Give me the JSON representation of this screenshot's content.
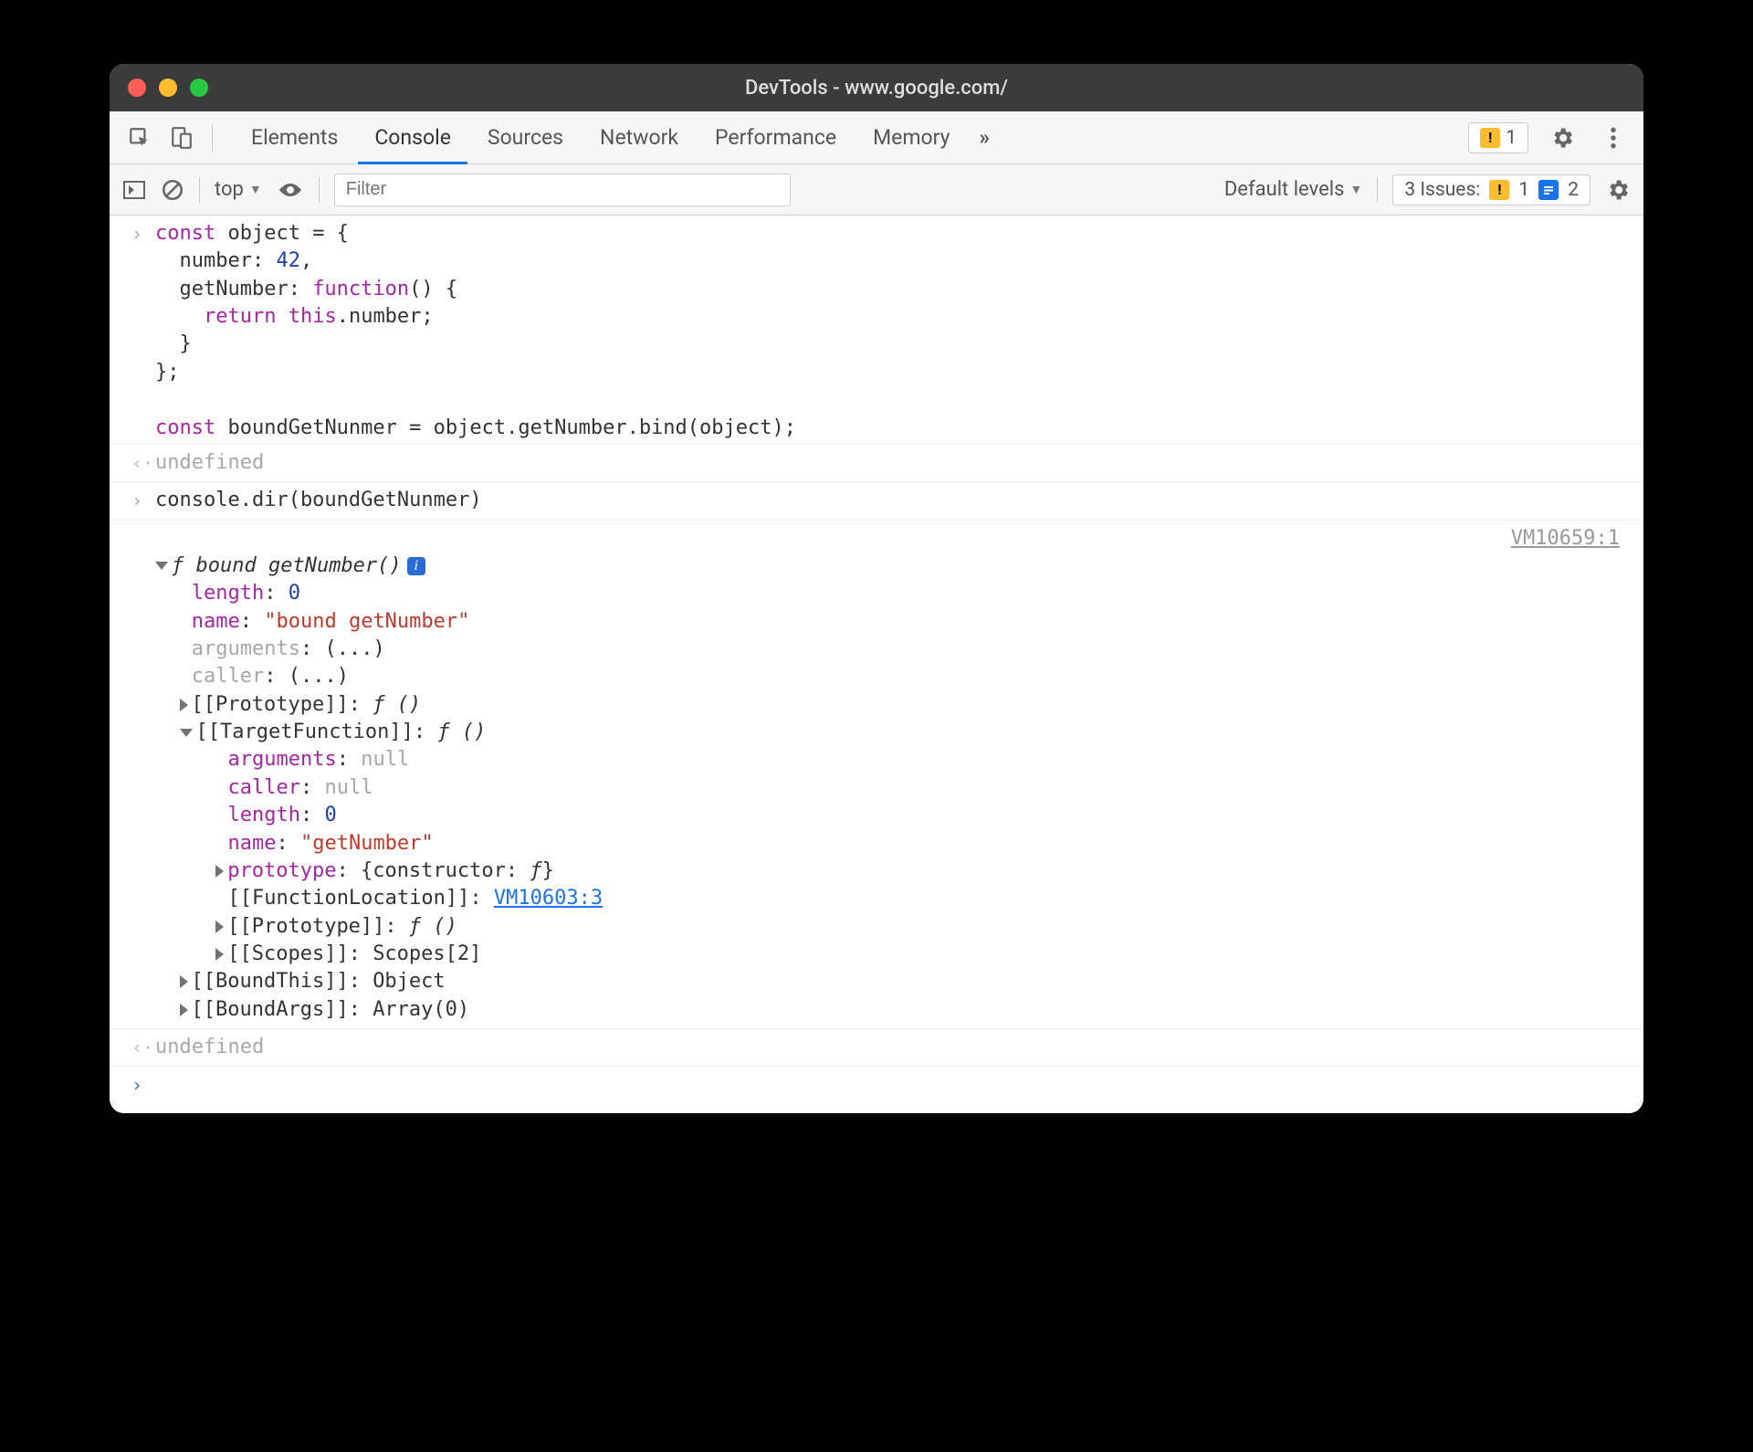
{
  "window": {
    "title": "DevTools - www.google.com/"
  },
  "tabs": [
    "Elements",
    "Console",
    "Sources",
    "Network",
    "Performance",
    "Memory"
  ],
  "active_tab": "Console",
  "overflow_glyph": "»",
  "top_warn_count": "1",
  "subbar": {
    "context": "top",
    "filter_placeholder": "Filter",
    "levels": "Default levels",
    "issues_prefix": "3 Issues:",
    "issues_warn": "1",
    "issues_info": "2"
  },
  "code": {
    "l1": "const object = {",
    "l2": "  number: 42,",
    "l3": "  getNumber: function() {",
    "l4": "    return this.number;",
    "l5": "  }",
    "l6": "};",
    "blank": "",
    "l7": "const boundGetNunmer = object.getNumber.bind(object);"
  },
  "undef": "undefined",
  "dir_call": "console.dir(boundGetNunmer)",
  "src_ref": "VM10659:1",
  "obj": {
    "header_prefix": "ƒ ",
    "header_name": "bound getNumber()",
    "length_k": "length",
    "length_v": "0",
    "name_k": "name",
    "name_v": "\"bound getNumber\"",
    "arguments_k": "arguments",
    "arguments_v": "(...)",
    "caller_k": "caller",
    "caller_v": "(...)",
    "proto_k": "[[Prototype]]",
    "proto_v": "ƒ ()",
    "target_k": "[[TargetFunction]]",
    "target_v": "ƒ ()",
    "t_args_k": "arguments",
    "t_args_v": "null",
    "t_caller_k": "caller",
    "t_caller_v": "null",
    "t_len_k": "length",
    "t_len_v": "0",
    "t_name_k": "name",
    "t_name_v": "\"getNumber\"",
    "t_proto_k": "prototype",
    "t_proto_v": "{constructor: ƒ}",
    "t_funcloc_k": "[[FunctionLocation]]",
    "t_funcloc_v": "VM10603:3",
    "t_proto2_k": "[[Prototype]]",
    "t_proto2_v": "ƒ ()",
    "t_scopes_k": "[[Scopes]]",
    "t_scopes_v": "Scopes[2]",
    "boundthis_k": "[[BoundThis]]",
    "boundthis_v": "Object",
    "boundargs_k": "[[BoundArgs]]",
    "boundargs_v": "Array(0)"
  }
}
